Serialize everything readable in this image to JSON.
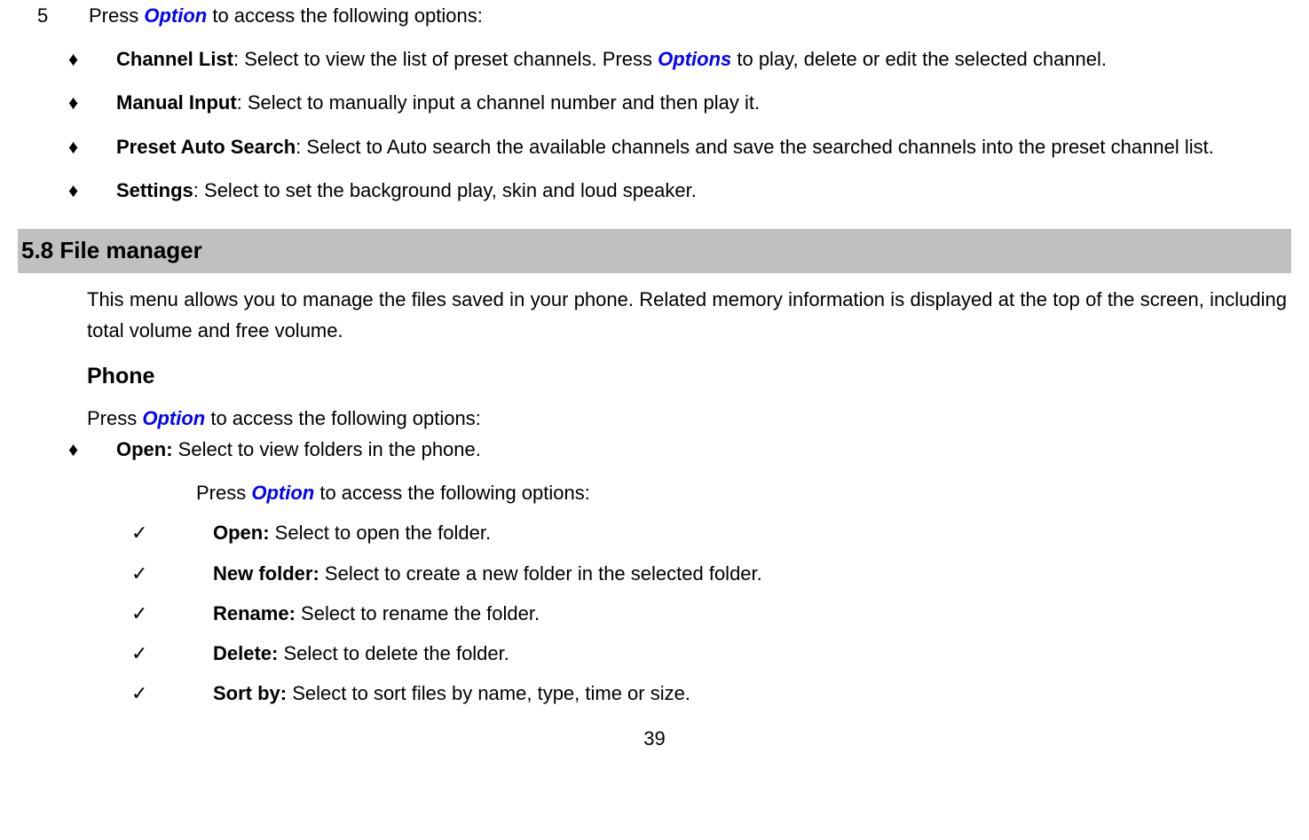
{
  "step": {
    "number": "5",
    "pressWord": "Press ",
    "option": "Option",
    "afterText": " to access the following options:"
  },
  "bullets": [
    {
      "bold": "Channel List",
      "afterBold": ": Select to view the list of preset channels. Press ",
      "blueText": "Options",
      "afterBlue": " to play, delete or edit the selected channel."
    },
    {
      "bold": "Manual Input",
      "afterBold": ": Select to manually input a channel number and then play it."
    },
    {
      "bold": "Preset Auto Search",
      "afterBold": ": Select to Auto search the available channels and save the searched channels into the preset channel list."
    },
    {
      "bold": "Settings",
      "afterBold": ": Select to set the background play, skin and loud speaker."
    }
  ],
  "section": {
    "heading": "5.8  File manager",
    "intro": "This menu allows you to manage the files saved in your phone. Related memory information is displayed at the top of the screen, including total volume and free volume.",
    "subHeading": "Phone",
    "pressLine": {
      "pre": "Press ",
      "option": "Option",
      "post": " to access the following options:"
    },
    "openBullet": {
      "bold": "Open: ",
      "after": "Select to view folders in the phone."
    },
    "openPressLine": {
      "pre": "Press ",
      "option": "Option",
      "post": " to access the following options:"
    },
    "checks": [
      {
        "bold": "Open: ",
        "after": "Select to open the folder."
      },
      {
        "bold": "New folder: ",
        "after": "Select to create a new folder in the selected folder."
      },
      {
        "bold": "Rename: ",
        "after": "Select to rename the folder."
      },
      {
        "bold": "Delete: ",
        "after": "Select to delete the folder."
      },
      {
        "bold": "Sort by: ",
        "after": "Select to sort files by name, type, time or size."
      }
    ]
  },
  "pageNumber": "39",
  "markers": {
    "diamond": "♦",
    "check": "✓"
  }
}
